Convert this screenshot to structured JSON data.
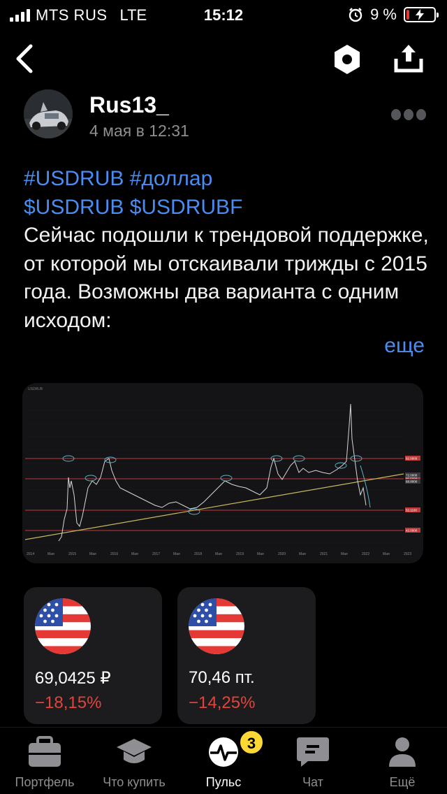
{
  "status_bar": {
    "carrier": "MTS RUS",
    "network": "LTE",
    "time": "15:12",
    "battery": "9 %",
    "battery_level": 0.09
  },
  "post": {
    "author": "Rus13_",
    "date": "4 мая в 12:31",
    "tags_line1": "#USDRUB #доллар",
    "tags_line2": "$USDRUB $USDRUBF",
    "body": "Сейчас подошли к трендовой поддержке, от которой мы отскаивали трижды с 2015 года. Возможны два варианта с одним исходом:",
    "more_label": "еще"
  },
  "chart_image": {
    "x_labels": [
      "2014",
      "Мая",
      "2015",
      "Мая",
      "2016",
      "Мая",
      "2017",
      "Мая",
      "2018",
      "Мая",
      "2019",
      "Мая",
      "2020",
      "Мая",
      "2021",
      "Мая",
      "2022",
      "Мая",
      "2023"
    ],
    "price_tags": [
      "92.0000",
      "85.5000",
      "72.0000",
      "68.8000",
      "52.1100",
      "42.0000"
    ],
    "colors": {
      "price_line": "#d8d8d8",
      "trend_line": "#c9b860",
      "level_line": "#c0393b",
      "marker": "#5fb6c8"
    }
  },
  "tickers": [
    {
      "price": "69,0425 ₽",
      "change": "−18,15%"
    },
    {
      "price": "70,46 пт.",
      "change": "−14,25%"
    }
  ],
  "tabbar": {
    "tabs": [
      {
        "label": "Портфель",
        "icon": "briefcase-icon"
      },
      {
        "label": "Что купить",
        "icon": "graduation-cap-icon"
      },
      {
        "label": "Пульс",
        "icon": "pulse-icon"
      },
      {
        "label": "Чат",
        "icon": "chat-icon"
      },
      {
        "label": "Ещё",
        "icon": "person-icon"
      }
    ],
    "active": "Пульс",
    "pulse_badge": "3"
  },
  "colors": {
    "link": "#4b8cf0",
    "negative": "#e5423b",
    "badge": "#fdd835"
  }
}
